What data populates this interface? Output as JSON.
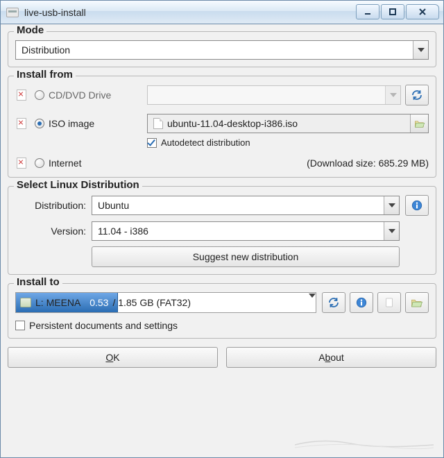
{
  "window": {
    "title": "live-usb-install"
  },
  "mode": {
    "legend": "Mode",
    "value": "Distribution"
  },
  "install_from": {
    "legend": "Install from",
    "options": {
      "cd_dvd": {
        "label": "CD/DVD Drive",
        "checked": false
      },
      "iso": {
        "label": "ISO image",
        "checked": true,
        "file": "ubuntu-11.04-desktop-i386.iso",
        "autodetect_label": "Autodetect distribution",
        "autodetect_checked": true
      },
      "internet": {
        "label": "Internet",
        "checked": false,
        "download_size": "(Download size: 685.29 MB)"
      }
    }
  },
  "select_dist": {
    "legend": "Select Linux Distribution",
    "distribution_label": "Distribution:",
    "distribution_value": "Ubuntu",
    "version_label": "Version:",
    "version_value": "11.04 - i386",
    "suggest_label": "Suggest new distribution"
  },
  "install_to": {
    "legend": "Install to",
    "drive_label": "L: MEENA",
    "used": "0.53",
    "total_text": " / 1.85 GB (FAT32)",
    "bar_percent": 34,
    "persistent_label": "Persistent documents and settings",
    "persistent_checked": false
  },
  "buttons": {
    "ok_pre": "",
    "ok_u": "O",
    "ok_post": "K",
    "about_pre": "A",
    "about_u": "b",
    "about_post": "out"
  }
}
